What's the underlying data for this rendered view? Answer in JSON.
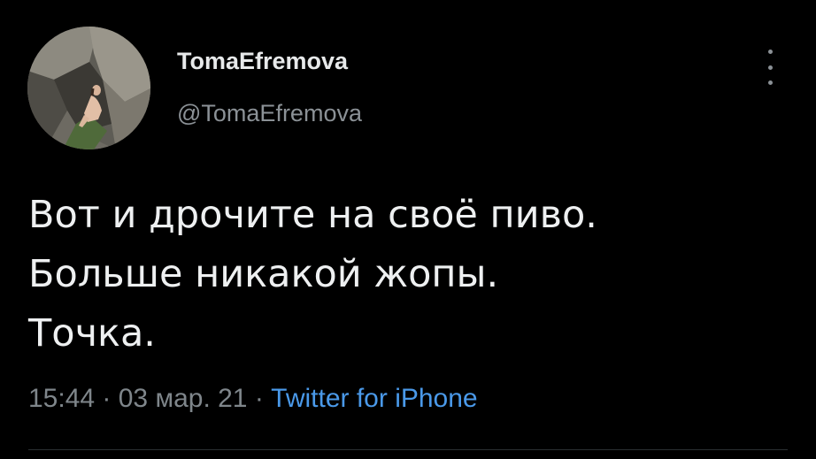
{
  "tweet": {
    "author": {
      "display_name": "TomaEfremova",
      "handle": "@TomaEfremova"
    },
    "text_lines": [
      "Вот и дрочите на своё пиво.",
      "Больше никакой жопы.",
      "Точка."
    ],
    "time": "15:44",
    "separator": " · ",
    "date": "03 мар. 21",
    "source": "Twitter for iPhone"
  },
  "colors": {
    "background": "#000000",
    "text": "#e7e9ea",
    "muted": "#7f868b",
    "link": "#4a99e9"
  },
  "icons": {
    "menu": "more-vertical-icon"
  }
}
